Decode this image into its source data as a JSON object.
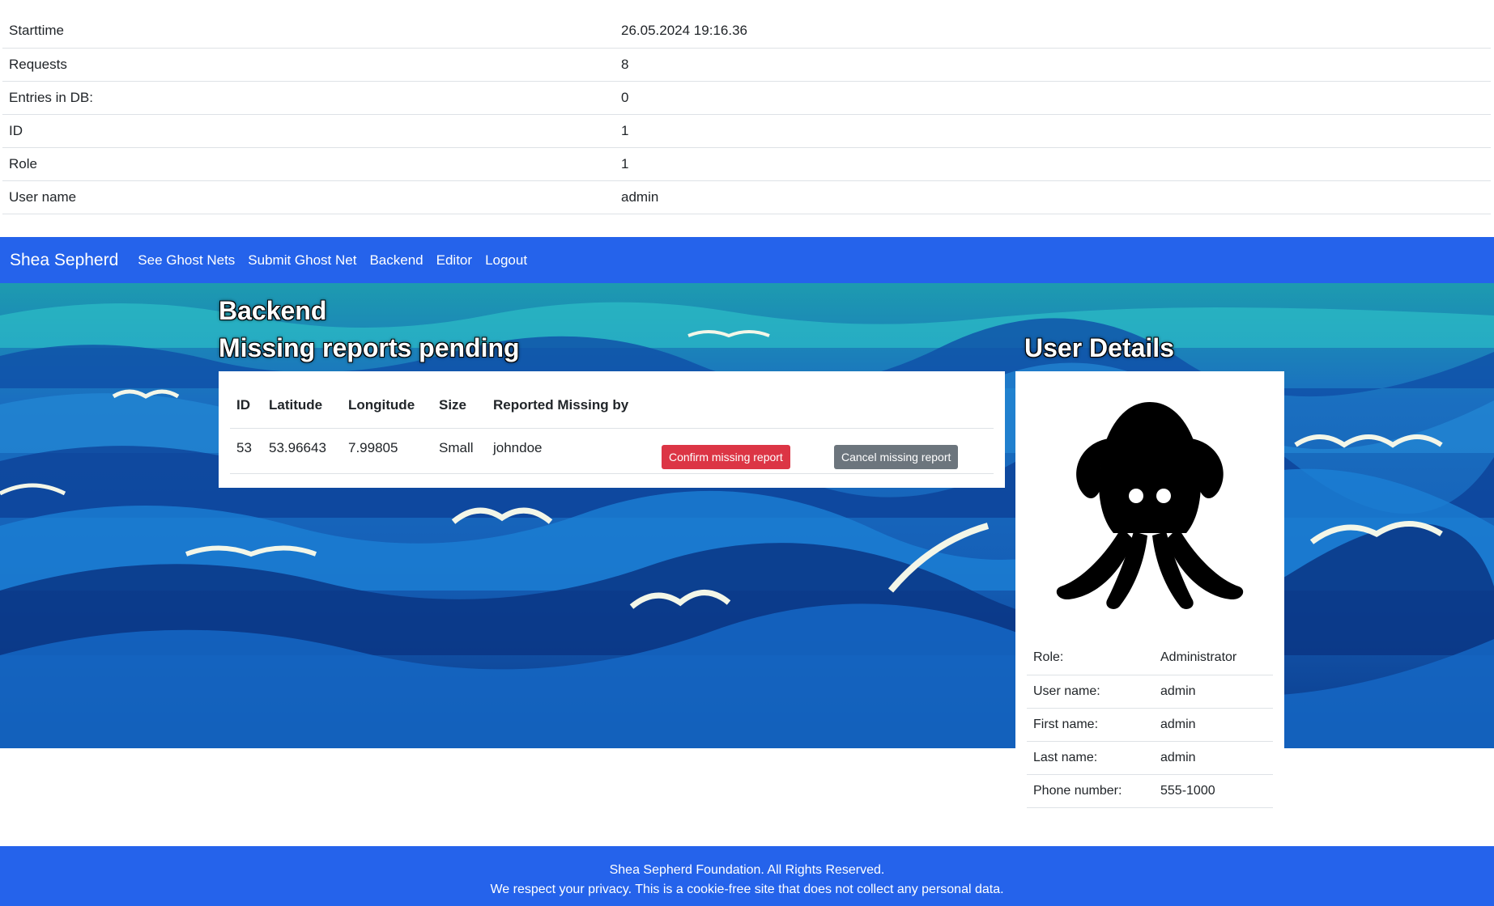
{
  "info": [
    {
      "key": "Starttime",
      "value": "26.05.2024 19:16.36"
    },
    {
      "key": "Requests",
      "value": "8"
    },
    {
      "key": "Entries in DB:",
      "value": "0"
    },
    {
      "key": "ID",
      "value": "1"
    },
    {
      "key": "Role",
      "value": "1"
    },
    {
      "key": "User name",
      "value": "admin"
    }
  ],
  "nav": {
    "brand": "Shea Sepherd",
    "links": [
      "See Ghost Nets",
      "Submit Ghost Net",
      "Backend",
      "Editor",
      "Logout"
    ]
  },
  "page": {
    "title": "Backend",
    "section_title": "Missing reports pending",
    "user_title": "User Details"
  },
  "reports": {
    "headers": [
      "ID",
      "Latitude",
      "Longitude",
      "Size",
      "Reported Missing by"
    ],
    "rows": [
      {
        "id": "53",
        "latitude": "53.96643",
        "longitude": "7.99805",
        "size": "Small",
        "reported_by": "johndoe",
        "confirm_label": "Confirm missing report",
        "cancel_label": "Cancel missing report"
      }
    ]
  },
  "user": {
    "avatar_icon": "octopus-icon",
    "details": [
      {
        "key": "Role:",
        "value": "Administrator"
      },
      {
        "key": "User name:",
        "value": "admin"
      },
      {
        "key": "First name:",
        "value": "admin"
      },
      {
        "key": "Last name:",
        "value": "admin"
      },
      {
        "key": "Phone number:",
        "value": "555-1000"
      }
    ]
  },
  "footer": {
    "line1": "Shea Sepherd Foundation. All Rights Reserved.",
    "line2": "We respect your privacy. This is a cookie-free site that does not collect any personal data."
  },
  "colors": {
    "nav_bg": "#2563eb",
    "danger": "#dc3545",
    "secondary": "#6c757d"
  }
}
